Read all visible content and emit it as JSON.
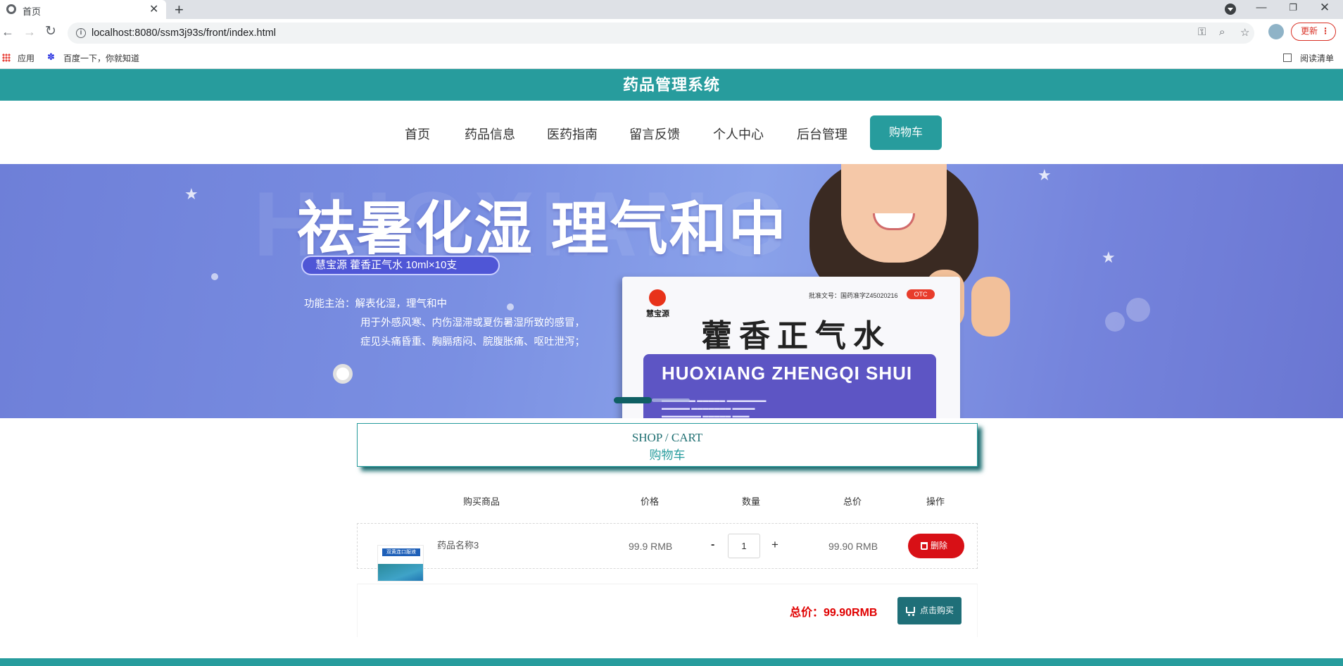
{
  "browser": {
    "tab_title": "首页",
    "tab_close": "✕",
    "new_tab": "+",
    "url": "localhost:8080/ssm3j93s/front/index.html",
    "update_label": "更新",
    "bookmarks": [
      {
        "label": "应用"
      },
      {
        "label": "百度一下，你就知道"
      }
    ],
    "reading_list": "阅读清单",
    "accent_update": "#d93025"
  },
  "site": {
    "title": "药品管理系统",
    "theme_color": "#279c9d",
    "nav": [
      "首页",
      "药品信息",
      "医药指南",
      "留言反馈",
      "个人中心",
      "后台管理"
    ],
    "nav_active": "购物车"
  },
  "banner": {
    "headline": "祛暑化湿  理气和中",
    "pill": "慧宝源    藿香正气水 10ml×10支",
    "func_line1": "功能主治：解表化湿，理气和中",
    "func_line2": "用于外感风寒、内伤湿滞或夏伤暑湿所致的感冒，",
    "func_line3": "症见头痛昏重、胸膈痞闷、脘腹胀痛、呕吐泄泻；",
    "box_brand": "慧宝源",
    "box_approval": "批准文号：国药准字Z45020216",
    "box_otc": "OTC",
    "box_cn_name": "藿香正气水",
    "box_en_name": "HUOXIANG ZHENGQI SHUI"
  },
  "cart": {
    "title_en": "SHOP / CART",
    "title_cn": "购物车",
    "headers": [
      "购买商品",
      "价格",
      "数量",
      "总价",
      "操作"
    ],
    "items": [
      {
        "thumb_text": "双黄连口服液",
        "name": "药品名称3",
        "price": "99.9 RMB",
        "quantity": "1",
        "total": "99.90 RMB",
        "delete_label": "删除"
      }
    ],
    "minus": "-",
    "plus": "+",
    "grand_total": "总价：99.90RMB",
    "buy_label": "点击购买"
  }
}
